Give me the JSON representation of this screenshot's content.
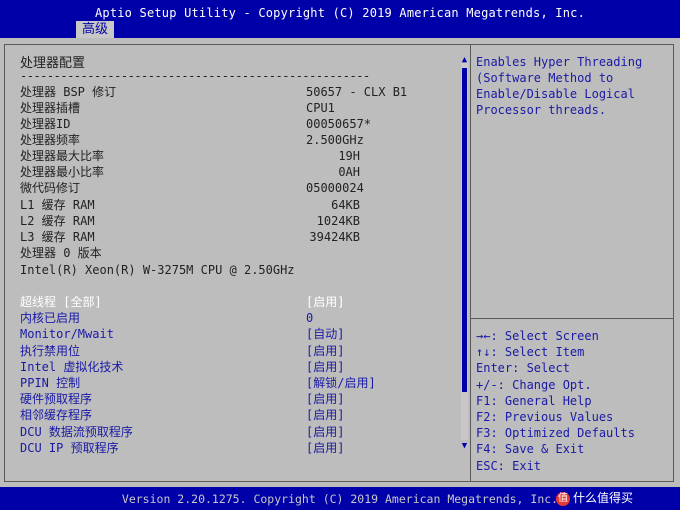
{
  "header": {
    "title": "Aptio Setup Utility - Copyright (C) 2019 American Megatrends, Inc.",
    "active_tab": "高级"
  },
  "footer": {
    "version": "Version 2.20.1275. Copyright (C) 2019 American Megatrends, Inc.",
    "watermark": "什么值得买"
  },
  "page": {
    "section_title": "处理器配置",
    "separator": "----------------------------------------------------"
  },
  "info_rows": [
    {
      "label": "处理器 BSP 修订",
      "value": "50657 - CLX B1"
    },
    {
      "label": "处理器插槽",
      "value": "CPU1"
    },
    {
      "label": "处理器ID",
      "value": "00050657*"
    },
    {
      "label": "处理器频率",
      "value": "2.500GHz"
    },
    {
      "label": "处理器最大比率",
      "value": "19H"
    },
    {
      "label": "处理器最小比率",
      "value": "0AH"
    },
    {
      "label": "微代码修订",
      "value": "05000024"
    },
    {
      "label": "L1 缓存 RAM",
      "value": "64KB"
    },
    {
      "label": "L2 缓存 RAM",
      "value": "1024KB"
    },
    {
      "label": "L3 缓存 RAM",
      "value": "39424KB"
    },
    {
      "label": "处理器 0 版本",
      "value": ""
    },
    {
      "label": "Intel(R) Xeon(R) W-3275M CPU @ 2.50GHz",
      "value": ""
    }
  ],
  "options": [
    {
      "label": "超线程 [全部]",
      "value": "[启用]"
    },
    {
      "label": "内核已启用",
      "value": "0"
    },
    {
      "label": "Monitor/Mwait",
      "value": "[自动]"
    },
    {
      "label": "执行禁用位",
      "value": "[启用]"
    },
    {
      "label": "Intel 虚拟化技术",
      "value": "[启用]"
    },
    {
      "label": "PPIN 控制",
      "value": "[解锁/启用]"
    },
    {
      "label": "硬件预取程序",
      "value": "[启用]"
    },
    {
      "label": "相邻缓存程序",
      "value": "[启用]"
    },
    {
      "label": "DCU 数据流预取程序",
      "value": "[启用]"
    },
    {
      "label": "DCU IP 预取程序",
      "value": "[启用]"
    }
  ],
  "help_text": [
    "Enables Hyper Threading",
    "(Software Method to",
    "Enable/Disable Logical",
    "Processor threads."
  ],
  "key_help": [
    "→←: Select Screen",
    "↑↓: Select Item",
    "Enter: Select",
    "+/-: Change Opt.",
    "F1: General Help",
    "F2: Previous Values",
    "F3: Optimized Defaults",
    "F4: Save & Exit",
    "ESC: Exit"
  ],
  "scrollbar": {
    "up_icon": "up-arrow-icon",
    "down_icon": "down-arrow-icon"
  },
  "colors": {
    "bar": "#0000a8",
    "panel": "#bdbdbd",
    "option_text": "#1a1aa6",
    "selected_text": "#ffffff"
  }
}
